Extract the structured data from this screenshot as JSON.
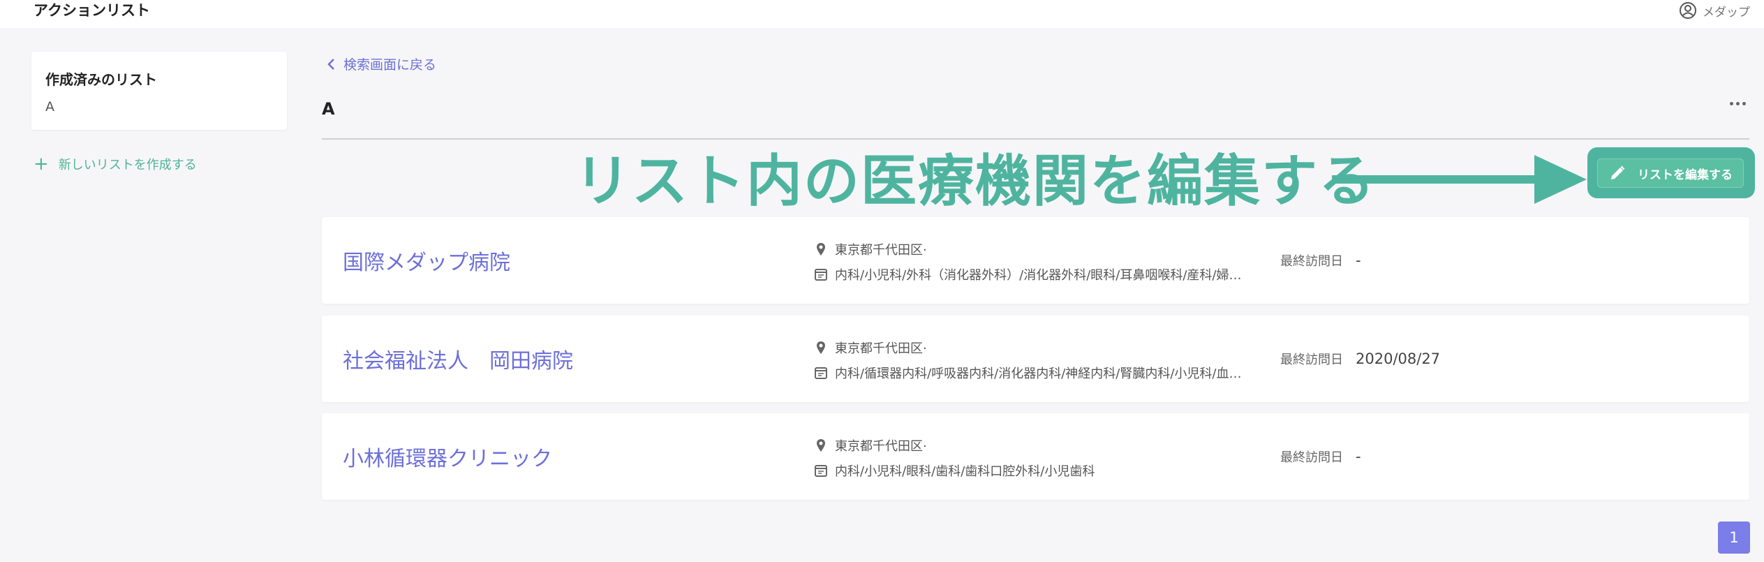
{
  "app": {
    "title": "アクションリスト"
  },
  "user": {
    "name": "メダップ"
  },
  "sidebar": {
    "title": "作成済みのリスト",
    "lists": [
      "A"
    ],
    "new_list_label": "新しいリストを作成する"
  },
  "main": {
    "back_label": "検索画面に戻る",
    "list_name": "A",
    "annotation_text": "リスト内の医療機関を編集する",
    "edit_button_label": "リストを編集する",
    "visit_label": "最終訪問日",
    "hospitals": [
      {
        "name": "国際メダップ病院",
        "address": "東京都千代田区·",
        "departments": "内科/小児科/外科（消化器外科）/消化器外科/眼科/耳鼻咽喉科/産科/婦…",
        "last_visit": "-"
      },
      {
        "name": "社会福祉法人　岡田病院",
        "address": "東京都千代田区·",
        "departments": "内科/循環器内科/呼吸器内科/消化器内科/神経内科/腎臓内科/小児科/血…",
        "last_visit": "2020/08/27"
      },
      {
        "name": "小林循環器クリニック",
        "address": "東京都千代田区·",
        "departments": "内科/小児科/眼科/歯科/歯科口腔外科/小児歯科",
        "last_visit": "-"
      }
    ]
  },
  "pagination": {
    "current_page": "1"
  },
  "colors": {
    "accent": "#6d6fd8",
    "green": "#4fb49f",
    "page_button": "#7b7de8"
  }
}
